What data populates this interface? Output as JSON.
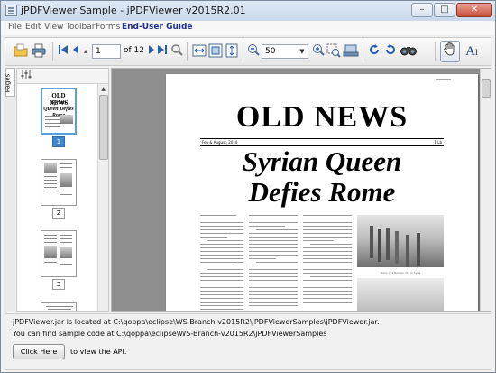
{
  "window": {
    "title": "jPDFViewer Sample - jPDFViewer v2015R2.01",
    "minimize": "–",
    "maximize": "□",
    "close": "✕"
  },
  "menu": {
    "items": [
      "File",
      "Edit",
      "View",
      "Toolbar",
      "Forms",
      "End-User Guide"
    ]
  },
  "toolbar": {
    "page_number": "1",
    "of_pages": "of 12",
    "zoom_value": "50",
    "icons": [
      "open-folder-icon",
      "print-icon",
      "first-page-icon",
      "previous-page-icon",
      "next-page-icon",
      "last-page-icon",
      "zoom-to-page-icon",
      "fit-width-icon",
      "fit-page-icon",
      "fit-height-icon",
      "zoom-out-icon",
      "zoom-in-icon",
      "zoom-region-icon",
      "page-mode-icon",
      "rotate-icon",
      "refresh-icon",
      "find-icon",
      "hand-tool-icon",
      "text-select-icon"
    ]
  },
  "sidebar": {
    "tab_label": "Pages",
    "thumbnails": [
      {
        "label": "1",
        "selected": true
      },
      {
        "label": "2",
        "selected": false
      },
      {
        "label": "3",
        "selected": false
      }
    ],
    "thumb1_title": "OLD NEWS",
    "thumb1_sub": "Syrian Queen Defies Rome"
  },
  "document": {
    "masthead": "OLD NEWS",
    "date_left": "Feb & August, 2010",
    "date_right": "1 Lb",
    "headline_line1": "Syrian Queen",
    "headline_line2": "Defies Rome",
    "photo_caption": "Ruins of a Roman city in Syria"
  },
  "info": {
    "line1": "jPDFViewer.jar is located at C:\\qoppa\\eclipse\\WS-Branch-v2015R2\\jPDFViewerSamples\\jPDFViewer.jar.",
    "line2": "You can find sample code at C:\\qoppa\\eclipse\\WS-Branch-v2015R2\\jPDFViewerSamples",
    "button_label": "Click Here",
    "button_suffix": "to view the API."
  },
  "colors": {
    "accent": "#2a5fa8",
    "selection": "#3f88d0",
    "guide_menu": "#1e2f8f"
  }
}
